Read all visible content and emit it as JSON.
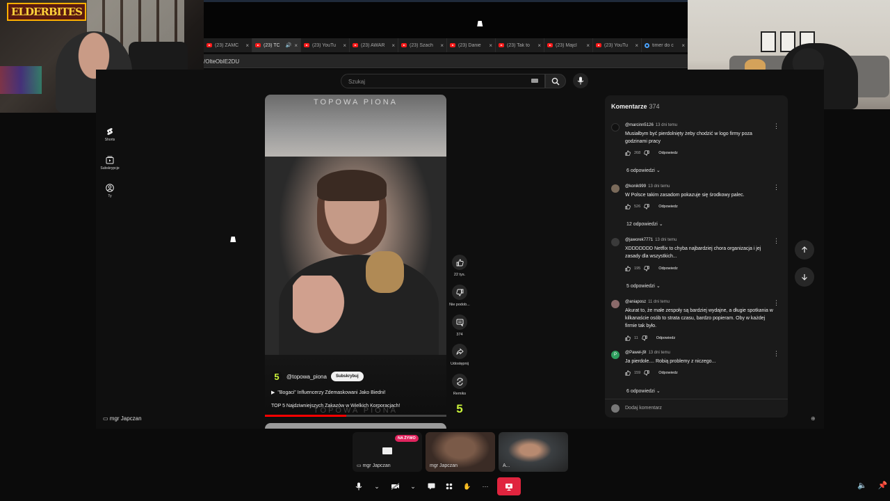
{
  "browser": {
    "tabs": [
      {
        "label": "(23) ZAMC",
        "icon": "youtube-icon",
        "active": false
      },
      {
        "label": "(23) TC",
        "icon": "youtube-icon",
        "active": true,
        "audio": true
      },
      {
        "label": "(23) YouTu",
        "icon": "youtube-icon",
        "active": false
      },
      {
        "label": "(23) AWAR",
        "icon": "youtube-icon",
        "active": false
      },
      {
        "label": "(23) Szach",
        "icon": "youtube-icon",
        "active": false
      },
      {
        "label": "(23) Danie",
        "icon": "youtube-icon",
        "active": false
      },
      {
        "label": "(23) Tak to",
        "icon": "youtube-icon",
        "active": false
      },
      {
        "label": "(23) Majcl",
        "icon": "youtube-icon",
        "active": false
      },
      {
        "label": "(23) YouTu",
        "icon": "youtube-icon",
        "active": false
      },
      {
        "label": "timer do c",
        "icon": "google-icon",
        "active": false
      }
    ],
    "url": "/OlteObIE2DU",
    "close_glyph": "×"
  },
  "streamer_logo": "ELDERBITES",
  "youtube": {
    "search_placeholder": "Szukaj",
    "nav": [
      {
        "label": "Shorts",
        "icon": "shorts-icon"
      },
      {
        "label": "Subskrypcje",
        "icon": "subscriptions-icon"
      },
      {
        "label": "Ty",
        "icon": "account-icon"
      }
    ],
    "short": {
      "watermark_top": "TOPOWA PIONA",
      "watermark_bottom": "TOPOWA PIONA",
      "channel_logo": "5",
      "channel": "@topowa_piona",
      "subscribe": "Subskrybuj",
      "title_line1": "\"Bogaci\" Influencerzy Zdemaskowani Jako Biedni!",
      "title_line2": "TOP 5 Najdziwniejszych Zakazów w Wielkich Korporacjach!",
      "progress": 0.45
    },
    "actions": [
      {
        "label": "22 tys.",
        "icon": "like-icon"
      },
      {
        "label": "Nie podob...",
        "icon": "dislike-icon"
      },
      {
        "label": "374",
        "icon": "comment-icon"
      },
      {
        "label": "Udostępnij",
        "icon": "share-icon"
      },
      {
        "label": "Remiks",
        "icon": "remix-icon"
      }
    ],
    "remix_logo": "5",
    "comments": {
      "title": "Komentarze",
      "count": "374",
      "items": [
        {
          "author": "@marcinn5126",
          "time": "13 dni temu",
          "text": "Musiałbym być pierdolnięty żeby chodzić w logo firmy poza godzinami pracy",
          "likes": "268",
          "reply": "Odpowiedz",
          "replies": "6 odpowiedzi",
          "avatar_color": "#111111"
        },
        {
          "author": "@konik999",
          "time": "13 dni temu",
          "text": "W Polsce takim zasadom pokazuje się środkowy palec.",
          "likes": "526",
          "reply": "Odpowiedz",
          "replies": "12 odpowiedzi",
          "avatar_color": "#7a6a5a"
        },
        {
          "author": "@jaworek7771",
          "time": "13 dni temu",
          "text": "XDDDDDDD Netflix to chyba najbardziej chora organizacja i jej zasady dla wszystkich...",
          "likes": "195",
          "reply": "Odpowiedz",
          "replies": "5 odpowiedzi",
          "avatar_color": "#3a3a3a"
        },
        {
          "author": "@aniaposz",
          "time": "11 dni temu",
          "text": "Akurat to, że małe zespoły są bardziej wydajne, a długie spotkania w kilkanaście osób to strata czasu, bardzo popieram. Oby w każdej firmie tak było.",
          "likes": "11",
          "reply": "Odpowiedz",
          "replies": "",
          "avatar_color": "#8a6a6a"
        },
        {
          "author": "@Paweł-j9l",
          "time": "13 dni temu",
          "text": "Ja pierdole.... Robią problemy z niczego...",
          "likes": "159",
          "reply": "Odpowiedz",
          "replies": "6 odpowiedzi",
          "avatar_color": "#2e9e5e",
          "avatar_letter": "P"
        }
      ],
      "add_placeholder": "Dodaj komentarz"
    }
  },
  "meeting": {
    "presenter": "mgr Japczan",
    "live_badge": "NA ŻYWO",
    "tiles": [
      {
        "name": "mgr Japczan",
        "type": "screen"
      },
      {
        "name": "mgr Japczan",
        "type": "camera"
      },
      {
        "name": "A...",
        "type": "camera"
      }
    ]
  }
}
